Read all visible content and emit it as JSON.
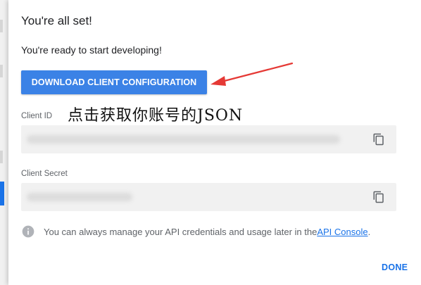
{
  "dialog": {
    "title": "You're all set!",
    "subtitle": "You're ready to start developing!",
    "download_button": "DOWNLOAD CLIENT CONFIGURATION",
    "client_id": {
      "label": "Client ID",
      "copy_icon": "copy-icon"
    },
    "client_secret": {
      "label": "Client Secret",
      "copy_icon": "copy-icon"
    },
    "info": {
      "icon": "info-icon",
      "text": "You can always manage your API credentials and usage later in the ",
      "link": "API Console",
      "period": "."
    },
    "done_button": "DONE"
  },
  "annotation": {
    "text": "点击获取你账号的JSON",
    "arrow_color": "#e53935"
  },
  "colors": {
    "primary": "#3b82e6",
    "link": "#1a73e8",
    "field_bg": "#f1f1f1"
  }
}
